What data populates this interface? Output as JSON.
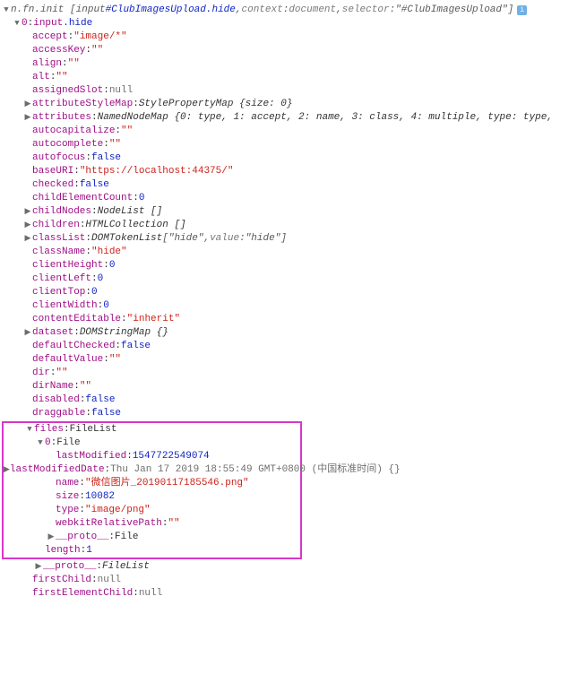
{
  "header": {
    "prefix": "n.fn.init",
    "bracket_open": "[",
    "tag": "input",
    "id": "#ClubImagesUpload",
    "cls": ".hide",
    "sep": ", ",
    "context_k": "context",
    "context_v": "document",
    "selector_k": "selector",
    "selector_v": "\"#ClubImagesUpload\"",
    "bracket_close": "]"
  },
  "line_0": {
    "key": "0",
    "tag": "input",
    "cls": ".hide"
  },
  "props": {
    "accept": {
      "k": "accept",
      "v": "\"image/*\"",
      "cls": "str"
    },
    "accessKey": {
      "k": "accessKey",
      "v": "\"\"",
      "cls": "str"
    },
    "align": {
      "k": "align",
      "v": "\"\"",
      "cls": "str"
    },
    "alt": {
      "k": "alt",
      "v": "\"\"",
      "cls": "str"
    },
    "assignedSlot": {
      "k": "assignedSlot",
      "v": "null",
      "cls": "nullv"
    },
    "attributeStyleMap": {
      "k": "attributeStyleMap",
      "v": "StylePropertyMap {size: 0}",
      "cls": "ital",
      "arrow": true
    },
    "attributes": {
      "k": "attributes",
      "v": "NamedNodeMap {0: type, 1: accept, 2: name, 3: class, 4: multiple, type: type,",
      "cls": "ital",
      "arrow": true
    },
    "autocapitalize": {
      "k": "autocapitalize",
      "v": "\"\"",
      "cls": "str"
    },
    "autocomplete": {
      "k": "autocomplete",
      "v": "\"\"",
      "cls": "str"
    },
    "autofocus": {
      "k": "autofocus",
      "v": "false",
      "cls": "bool"
    },
    "baseURI": {
      "k": "baseURI",
      "v": "\"https://localhost:44375/\"",
      "cls": "str"
    },
    "checked": {
      "k": "checked",
      "v": "false",
      "cls": "bool"
    },
    "childElementCount": {
      "k": "childElementCount",
      "v": "0",
      "cls": "num"
    },
    "childNodes": {
      "k": "childNodes",
      "v": "NodeList []",
      "cls": "ital",
      "arrow": true
    },
    "children": {
      "k": "children",
      "v": "HTMLCollection []",
      "cls": "ital",
      "arrow": true
    },
    "className": {
      "k": "className",
      "v": "\"hide\"",
      "cls": "str"
    },
    "clientHeight": {
      "k": "clientHeight",
      "v": "0",
      "cls": "num"
    },
    "clientLeft": {
      "k": "clientLeft",
      "v": "0",
      "cls": "num"
    },
    "clientTop": {
      "k": "clientTop",
      "v": "0",
      "cls": "num"
    },
    "clientWidth": {
      "k": "clientWidth",
      "v": "0",
      "cls": "num"
    },
    "contentEditable": {
      "k": "contentEditable",
      "v": "\"inherit\"",
      "cls": "str"
    },
    "dataset": {
      "k": "dataset",
      "v": "DOMStringMap {}",
      "cls": "ital",
      "arrow": true
    },
    "defaultChecked": {
      "k": "defaultChecked",
      "v": "false",
      "cls": "bool"
    },
    "defaultValue": {
      "k": "defaultValue",
      "v": "\"\"",
      "cls": "str"
    },
    "dir": {
      "k": "dir",
      "v": "\"\"",
      "cls": "str"
    },
    "dirName": {
      "k": "dirName",
      "v": "\"\"",
      "cls": "str"
    },
    "disabled": {
      "k": "disabled",
      "v": "false",
      "cls": "bool"
    },
    "draggable": {
      "k": "draggable",
      "v": "false",
      "cls": "bool"
    },
    "proto": {
      "k": "__proto__",
      "v": "FileList",
      "cls": "ital",
      "arrow": true
    },
    "firstChild": {
      "k": "firstChild",
      "v": "null",
      "cls": "nullv"
    },
    "firstElementChild": {
      "k": "firstElementChild",
      "v": "null",
      "cls": "nullv"
    }
  },
  "classList": {
    "k": "classList",
    "type": "DOMTokenList",
    "open": "[",
    "item": "\"hide\"",
    "value_k": "value",
    "value_v": "\"hide\"",
    "close": "]"
  },
  "files": {
    "k": "files",
    "type": "FileList",
    "idx": "0",
    "idx_type": "File",
    "lastModified": {
      "k": "lastModified",
      "v": "1547722549074"
    },
    "lastModifiedDate": {
      "k": "lastModifiedDate",
      "v": "Thu Jan 17 2019 18:55:49 GMT+0800 (中国标准时间) {}"
    },
    "name": {
      "k": "name",
      "v": "\"微信图片_20190117185546.png\""
    },
    "size": {
      "k": "size",
      "v": "10082"
    },
    "ftype": {
      "k": "type",
      "v": "\"image/png\""
    },
    "webkit": {
      "k": "webkitRelativePath",
      "v": "\"\""
    },
    "proto": {
      "k": "__proto__",
      "v": "File"
    },
    "length": {
      "k": "length",
      "v": "1"
    }
  }
}
